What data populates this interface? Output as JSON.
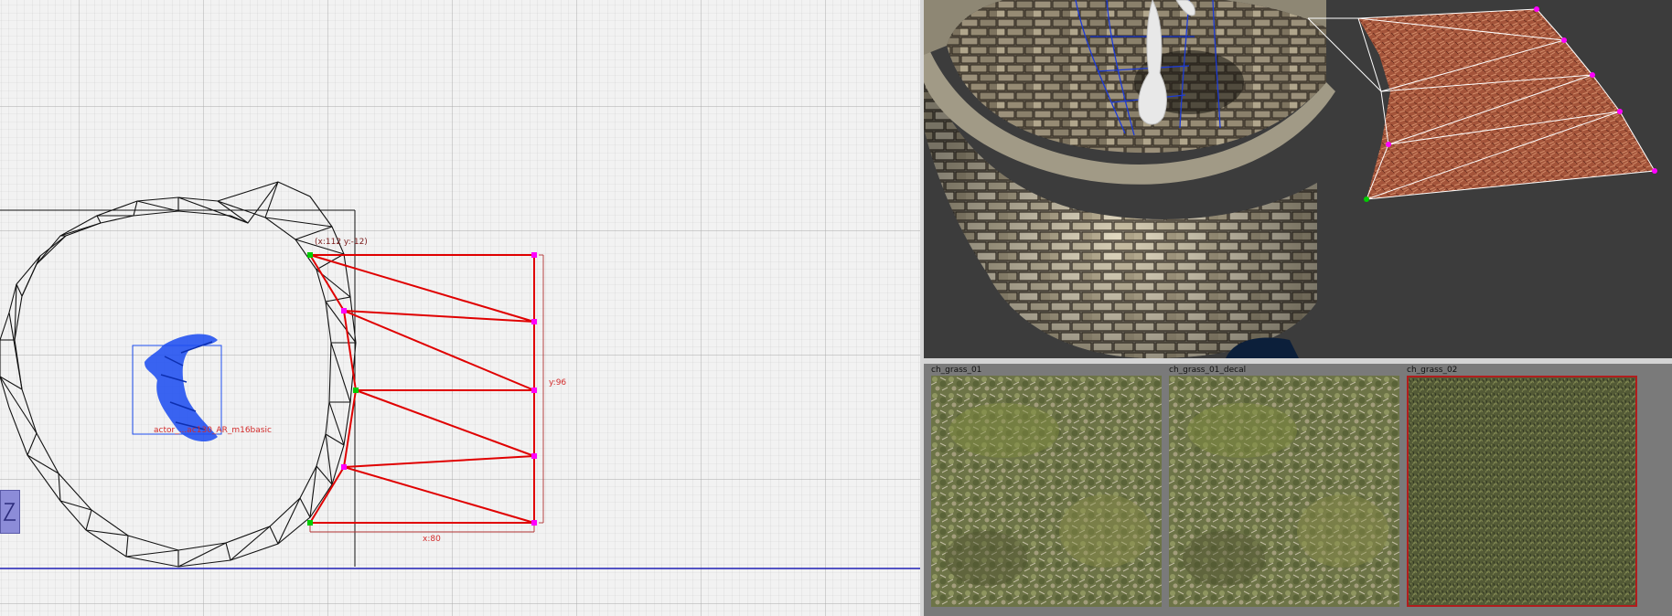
{
  "grid_view": {
    "vertex_readout": "(x:112  y:-12)",
    "entity_label": "actor_...ac130_AR_m16basic",
    "height_label": "y:96",
    "width_label": "x:80"
  },
  "texture_browser": {
    "tiles": [
      {
        "name": "ch_grass_01",
        "selected": false
      },
      {
        "name": "ch_grass_01_decal",
        "selected": false
      },
      {
        "name": "ch_grass_02",
        "selected": true
      }
    ]
  },
  "colors": {
    "grid_bg": "#f2f2f2",
    "grid_line": "#c8c8c8",
    "brush_selected": "#e00000",
    "vertex_handle": "#ff00ff",
    "vertex_selected": "#00cc00",
    "axis_line": "#1e1eb4",
    "entity": "#1f4ff0",
    "selection_border": "#b21d1d"
  }
}
